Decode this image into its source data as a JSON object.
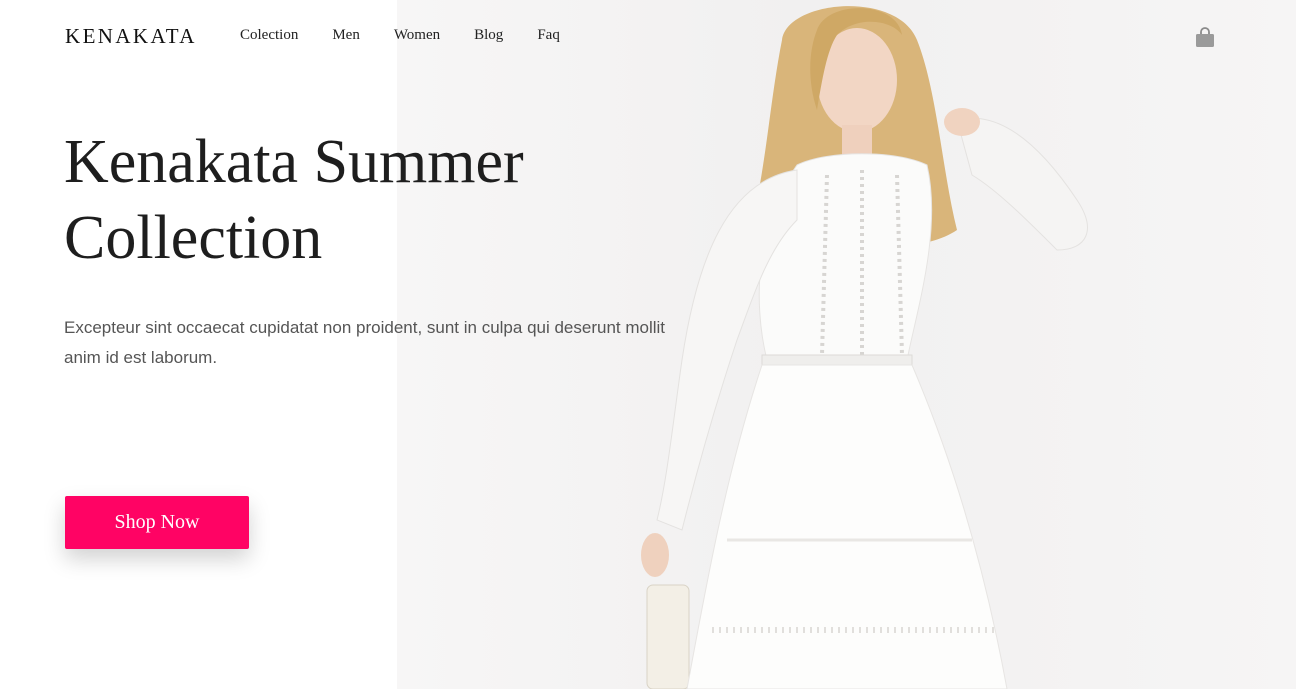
{
  "brand": {
    "logo": "KENAKATA"
  },
  "nav": {
    "items": [
      {
        "label": "Colection"
      },
      {
        "label": "Men"
      },
      {
        "label": "Women"
      },
      {
        "label": "Blog"
      },
      {
        "label": "Faq"
      }
    ],
    "cart_icon": "shopping-bag-icon"
  },
  "hero": {
    "title": "Kenakata Summer Collection",
    "description": "Excepteur sint occaecat cupidatat non proident, sunt in culpa qui deserunt mollit anim id est laborum.",
    "cta_label": "Shop Now",
    "cta_color": "#ff0364",
    "image": "model-white-dress-photo"
  }
}
